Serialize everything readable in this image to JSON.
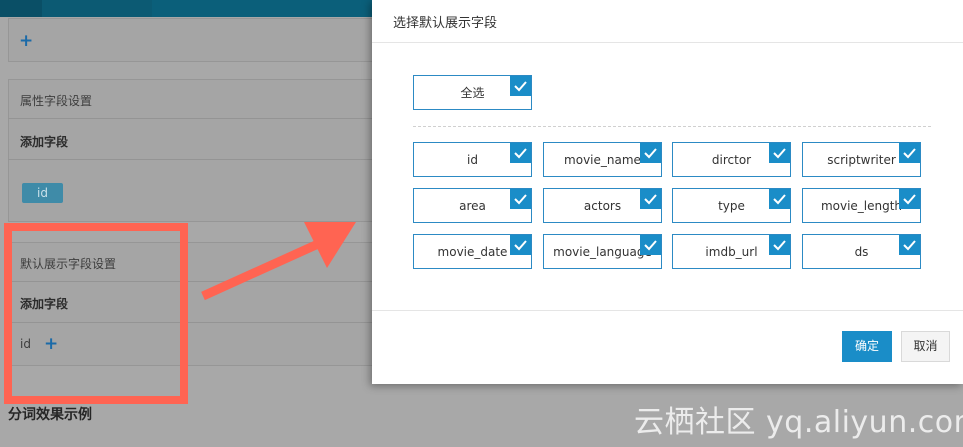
{
  "background": {
    "sections": {
      "attr_title": "属性字段设置",
      "add_field_1": "添加字段",
      "tag_id": "id",
      "default_title": "默认展示字段设置",
      "add_field_2": "添加字段",
      "default_field": "id",
      "footer_title": "分词效果示例"
    },
    "icons": {
      "plus": "+",
      "plus_icon": "plus-icon"
    }
  },
  "modal": {
    "title": "选择默认展示字段",
    "select_all": {
      "label": "全选",
      "checked": true
    },
    "fields": [
      {
        "label": "id",
        "checked": true
      },
      {
        "label": "movie_name",
        "checked": true
      },
      {
        "label": "dirctor",
        "checked": true
      },
      {
        "label": "scriptwriter",
        "checked": true
      },
      {
        "label": "area",
        "checked": true
      },
      {
        "label": "actors",
        "checked": true
      },
      {
        "label": "type",
        "checked": true
      },
      {
        "label": "movie_length",
        "checked": true
      },
      {
        "label": "movie_date",
        "checked": true
      },
      {
        "label": "movie_language",
        "checked": true
      },
      {
        "label": "imdb_url",
        "checked": true
      },
      {
        "label": "ds",
        "checked": true
      }
    ],
    "buttons": {
      "ok": "确定",
      "cancel": "取消"
    }
  },
  "watermark": "云栖社区 yq.aliyun.com",
  "colors": {
    "accent": "#1a8dc8",
    "annotation": "#ff6452"
  }
}
